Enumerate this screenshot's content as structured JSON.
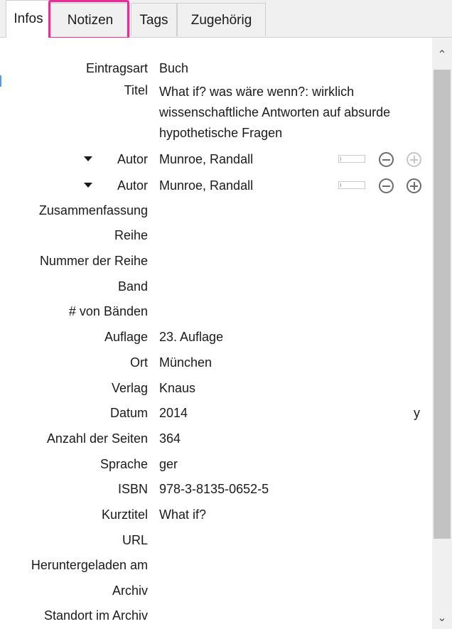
{
  "tabs": [
    {
      "label": "Infos",
      "active": true
    },
    {
      "label": "Notizen",
      "highlighted": true
    },
    {
      "label": "Tags"
    },
    {
      "label": "Zugehörig"
    }
  ],
  "fields": {
    "eintragsart": {
      "label": "Eintragsart",
      "value": "Buch"
    },
    "titel": {
      "label": "Titel",
      "value": "What if? was wäre wenn?: wirklich wissenschaftliche Antworten auf absurde hypothetische Fragen"
    },
    "autor1": {
      "label": "Autor",
      "value": "Munroe, Randall"
    },
    "autor2": {
      "label": "Autor",
      "value": "Munroe, Randall"
    },
    "zusammenfassung": {
      "label": "Zusammenfassung",
      "value": ""
    },
    "reihe": {
      "label": "Reihe",
      "value": ""
    },
    "nummer_reihe": {
      "label": "Nummer der Reihe",
      "value": ""
    },
    "band": {
      "label": "Band",
      "value": ""
    },
    "von_baenden": {
      "label": "# von Bänden",
      "value": ""
    },
    "auflage": {
      "label": "Auflage",
      "value": "23. Auflage"
    },
    "ort": {
      "label": "Ort",
      "value": "München"
    },
    "verlag": {
      "label": "Verlag",
      "value": "Knaus"
    },
    "datum": {
      "label": "Datum",
      "value": "2014",
      "extra": "y"
    },
    "seiten": {
      "label": "Anzahl der Seiten",
      "value": "364"
    },
    "sprache": {
      "label": "Sprache",
      "value": "ger"
    },
    "isbn": {
      "label": "ISBN",
      "value": "978-3-8135-0652-5"
    },
    "kurztitel": {
      "label": "Kurztitel",
      "value": "What if?"
    },
    "url": {
      "label": "URL",
      "value": ""
    },
    "heruntergeladen": {
      "label": "Heruntergeladen am",
      "value": ""
    },
    "archiv": {
      "label": "Archiv",
      "value": ""
    },
    "standort": {
      "label": "Standort im Archiv",
      "value": ""
    }
  },
  "scrollbar": {
    "up_glyph": "⌃",
    "down_glyph": "⌄"
  },
  "colors": {
    "highlight": "#ee2a9b",
    "tabbar_bg": "#f0f0f0",
    "scroll_thumb": "#c2c2c2"
  }
}
